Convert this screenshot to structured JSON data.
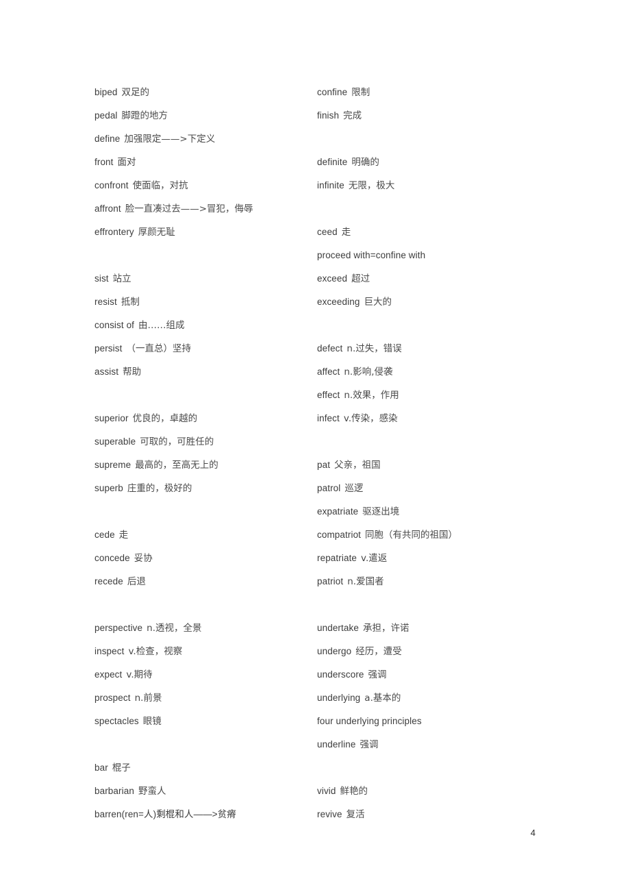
{
  "document": {
    "page_number": "4",
    "background_color": "#ffffff",
    "text_color": "#3a3a3a"
  },
  "rows": [
    {
      "left": {
        "term": "biped",
        "gloss": "双足的"
      },
      "right": {
        "term": "confine",
        "gloss": "限制"
      }
    },
    {
      "left": {
        "term": "pedal",
        "gloss": "脚蹬的地方"
      },
      "right": {
        "term": "finish",
        "gloss": "完成"
      }
    },
    {
      "left": {
        "term": "define",
        "gloss": "加强限定——>下定义"
      },
      "right": null
    },
    {
      "left": {
        "term": "front",
        "gloss": "面对"
      },
      "right": {
        "term": "definite",
        "gloss": "明确的"
      }
    },
    {
      "left": {
        "term": "confront",
        "gloss": "使面临，对抗"
      },
      "right": {
        "term": "infinite",
        "gloss": "无限，极大"
      }
    },
    {
      "left": {
        "term": "affront",
        "gloss": "脸一直凑过去——>冒犯，侮辱"
      },
      "right": null
    },
    {
      "left": {
        "term": "effrontery",
        "gloss": "厚颜无耻"
      },
      "right": {
        "term": "ceed",
        "gloss": "走"
      }
    },
    {
      "left": null,
      "right": {
        "term": "proceed with=confine with",
        "gloss": ""
      }
    },
    {
      "left": {
        "term": "sist",
        "gloss": "站立"
      },
      "right": {
        "term": "exceed",
        "gloss": "超过"
      }
    },
    {
      "left": {
        "term": "resist",
        "gloss": "抵制"
      },
      "right": {
        "term": "exceeding",
        "gloss": "巨大的"
      }
    },
    {
      "left": {
        "term": "consist of",
        "gloss": "由……组成"
      },
      "right": null
    },
    {
      "left": {
        "term": "persist",
        "gloss": "（一直总）坚持"
      },
      "right": {
        "term": "defect",
        "gloss": "n.过失，错误"
      }
    },
    {
      "left": {
        "term": "assist",
        "gloss": "帮助"
      },
      "right": {
        "term": "affect",
        "gloss": "n.影响,侵袭"
      }
    },
    {
      "left": null,
      "right": {
        "term": "effect",
        "gloss": "n.效果，作用"
      }
    },
    {
      "left": {
        "term": "superior",
        "gloss": "优良的，卓越的"
      },
      "right": {
        "term": "infect",
        "gloss": "v.传染，感染"
      }
    },
    {
      "left": {
        "term": "superable",
        "gloss": "可取的，可胜任的"
      },
      "right": null
    },
    {
      "left": {
        "term": "supreme",
        "gloss": "最高的，至高无上的"
      },
      "right": {
        "term": "pat",
        "gloss": "父亲，祖国"
      }
    },
    {
      "left": {
        "term": "superb",
        "gloss": "庄重的，极好的"
      },
      "right": {
        "term": "patrol",
        "gloss": "巡逻"
      }
    },
    {
      "left": null,
      "right": {
        "term": "expatriate",
        "gloss": "驱逐出境"
      }
    },
    {
      "left": {
        "term": "cede",
        "gloss": "走"
      },
      "right": {
        "term": "compatriot",
        "gloss": "同胞（有共同的祖国）"
      }
    },
    {
      "left": {
        "term": "concede",
        "gloss": "妥协"
      },
      "right": {
        "term": "repatriate",
        "gloss": "v.遣返"
      }
    },
    {
      "left": {
        "term": "recede",
        "gloss": "后退"
      },
      "right": {
        "term": "patriot",
        "gloss": "n.爱国者"
      }
    },
    {
      "left": null,
      "right": null
    },
    {
      "left": {
        "term": "perspective",
        "gloss": "n.透视，全景"
      },
      "right": {
        "term": "undertake",
        "gloss": "承担，许诺"
      }
    },
    {
      "left": {
        "term": "inspect",
        "gloss": "v.检查，视察"
      },
      "right": {
        "term": "undergo",
        "gloss": "经历，遭受"
      }
    },
    {
      "left": {
        "term": "expect",
        "gloss": "v.期待"
      },
      "right": {
        "term": "underscore",
        "gloss": "强调"
      }
    },
    {
      "left": {
        "term": "prospect",
        "gloss": "n.前景"
      },
      "right": {
        "term": "underlying",
        "gloss": "a.基本的"
      }
    },
    {
      "left": {
        "term": "spectacles",
        "gloss": "眼镜"
      },
      "right": {
        "term": "four underlying principles",
        "gloss": ""
      }
    },
    {
      "left": null,
      "right": {
        "term": "underline",
        "gloss": "强调"
      }
    },
    {
      "left": {
        "term": "bar",
        "gloss": "棍子"
      },
      "right": null
    },
    {
      "left": {
        "term": "barbarian",
        "gloss": "野蛮人"
      },
      "right": {
        "term": "vivid",
        "gloss": "鲜艳的"
      }
    },
    {
      "left": {
        "term": "barren(ren=人)剩棍和人——>贫瘠",
        "gloss": ""
      },
      "right": {
        "term": "revive",
        "gloss": "复活"
      }
    }
  ]
}
